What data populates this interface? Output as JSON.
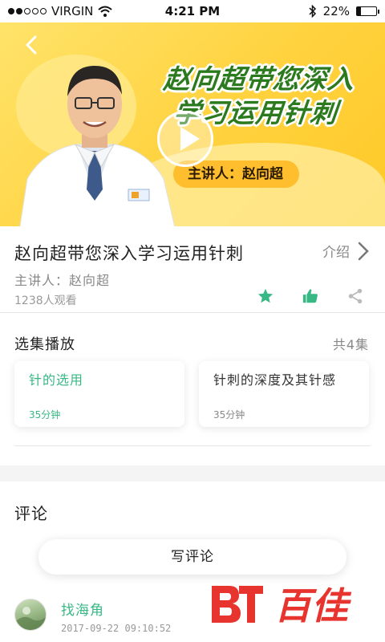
{
  "status_bar": {
    "carrier": "VIRGIN",
    "time": "4:21 PM",
    "battery": "22%",
    "battery_level": 0.22
  },
  "hero": {
    "title_line1": "赵向超带您深入",
    "title_line2": "学习运用针刺",
    "speaker": "主讲人：赵向超"
  },
  "course": {
    "title": "赵向超带您深入学习运用针刺",
    "intro_label": "介绍",
    "lecturer": "主讲人：赵向超",
    "views": "1238人观看"
  },
  "episodes": {
    "label": "选集播放",
    "count": "共4集",
    "items": [
      {
        "name": "针的选用",
        "duration": "35分钟"
      },
      {
        "name": "针刺的深度及其针感",
        "duration": "35分钟"
      }
    ]
  },
  "comments": {
    "label": "评论",
    "write_label": "写评论",
    "items": [
      {
        "user": "找海角",
        "time": "2017-09-22 09:10:52"
      }
    ]
  },
  "watermark": {
    "text": "百佳"
  },
  "colors": {
    "accent": "#38b884",
    "hero_bg": "#ffd23e",
    "title_green": "#2b7a1d",
    "watermark_red": "#e8342e"
  }
}
